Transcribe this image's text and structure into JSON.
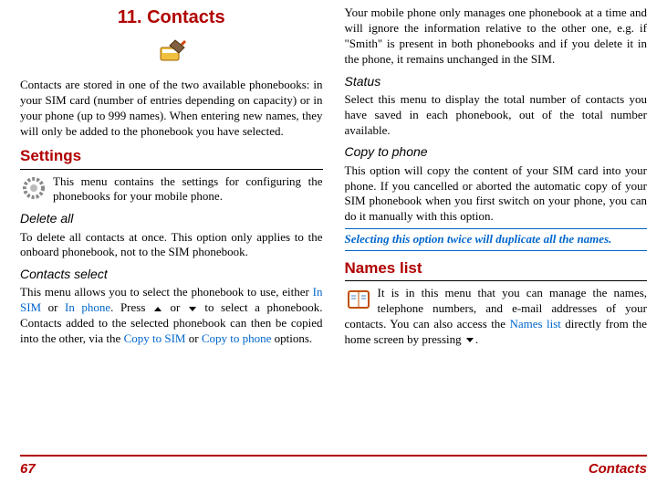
{
  "chapterTitle": "11. Contacts",
  "intro": "Contacts are stored in one of the two available phonebooks: in your SIM card (number of entries depending on capacity) or in your phone (up to 999 names). When entering new names, they will only be added to the phonebook you have selected.",
  "settingsHeading": "Settings",
  "settingsDesc": "This menu contains the settings for configuring the phonebooks for your mobile phone.",
  "deleteAll": {
    "title": "Delete all",
    "text": "To delete all contacts at once. This option only applies to the onboard phonebook, not to the SIM phonebook."
  },
  "contactsSelect": {
    "title": "Contacts select",
    "pre": "This menu allows you to select the phonebook to use, either ",
    "inSim": "In SIM",
    "or1": " or ",
    "inPhone": "In phone",
    "mid1": ". Press ",
    "or2": " or ",
    "mid2": " to select a phonebook. Contacts added to the selected phonebook can then be copied into the other, via the ",
    "copySim": "Copy to SIM",
    "or3": " or ",
    "copyPhone": "Copy to phone",
    "end": " options."
  },
  "topRight": "Your mobile phone only manages one phonebook at a time and will ignore the information relative to the other one, e.g. if \"Smith\" is present in both phonebooks and if you delete it in the phone, it remains unchanged in the SIM.",
  "status": {
    "title": "Status",
    "text": "Select this menu to display the total number of contacts you have saved in each phonebook, out of the total number available."
  },
  "copyPhone": {
    "title": "Copy to phone",
    "text": "This option will copy the content of your SIM card into your phone. If you cancelled or aborted the automatic copy of your SIM phonebook when you first switch on your phone, you can do it manually with this option."
  },
  "warning": "Selecting this option twice will duplicate all the names.",
  "namesListHeading": "Names list",
  "namesList": {
    "pre": "It is in this menu that you can manage the names, telephone numbers, and e-mail addresses of your contacts. You can also access the ",
    "link": "Names list",
    "mid": " directly from the home screen by pressing ",
    "end": "."
  },
  "footer": {
    "page": "67",
    "section": "Contacts"
  }
}
